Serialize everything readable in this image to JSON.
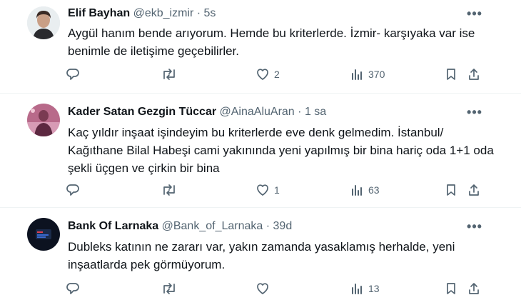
{
  "tweets": [
    {
      "name": "Elif Bayhan",
      "handle": "@ekb_izmir",
      "time": "5s",
      "text": "Aygül hanım bende arıyorum. Hemde bu kriterlerde. İzmir- karşıyaka var ise benimle de iletişime geçebilirler.",
      "replies": "",
      "retweets": "",
      "likes": "2",
      "views": "370"
    },
    {
      "name": "Kader Satan Gezgin Tüccar",
      "handle": "@AinaAluAran",
      "time": "1 sa",
      "text": "Kaç yıldır inşaat işindeyim  bu kriterlerde eve denk gelmedim. İstanbul/ Kağıthane Bilal Habeşi cami yakınında yeni yapılmış bir bina hariç oda 1+1 oda şekli üçgen ve çirkin bir bina",
      "replies": "",
      "retweets": "",
      "likes": "1",
      "views": "63"
    },
    {
      "name": "Bank Of Larnaka",
      "handle": "@Bank_of_Larnaka",
      "time": "39d",
      "text": "Dubleks katının ne zararı var, yakın zamanda yasaklamış herhalde, yeni inşaatlarda pek görmüyorum.",
      "replies": "",
      "retweets": "",
      "likes": "",
      "views": "13"
    }
  ],
  "separator": "·",
  "icons": {
    "reply": "reply-icon",
    "retweet": "retweet-icon",
    "like": "heart-icon",
    "views": "views-chart-icon",
    "bookmark": "bookmark-icon",
    "share": "share-icon",
    "more": "more-dots-icon"
  },
  "colors": {
    "text": "#0f1419",
    "muted": "#536471",
    "divider": "#eff3f4"
  }
}
